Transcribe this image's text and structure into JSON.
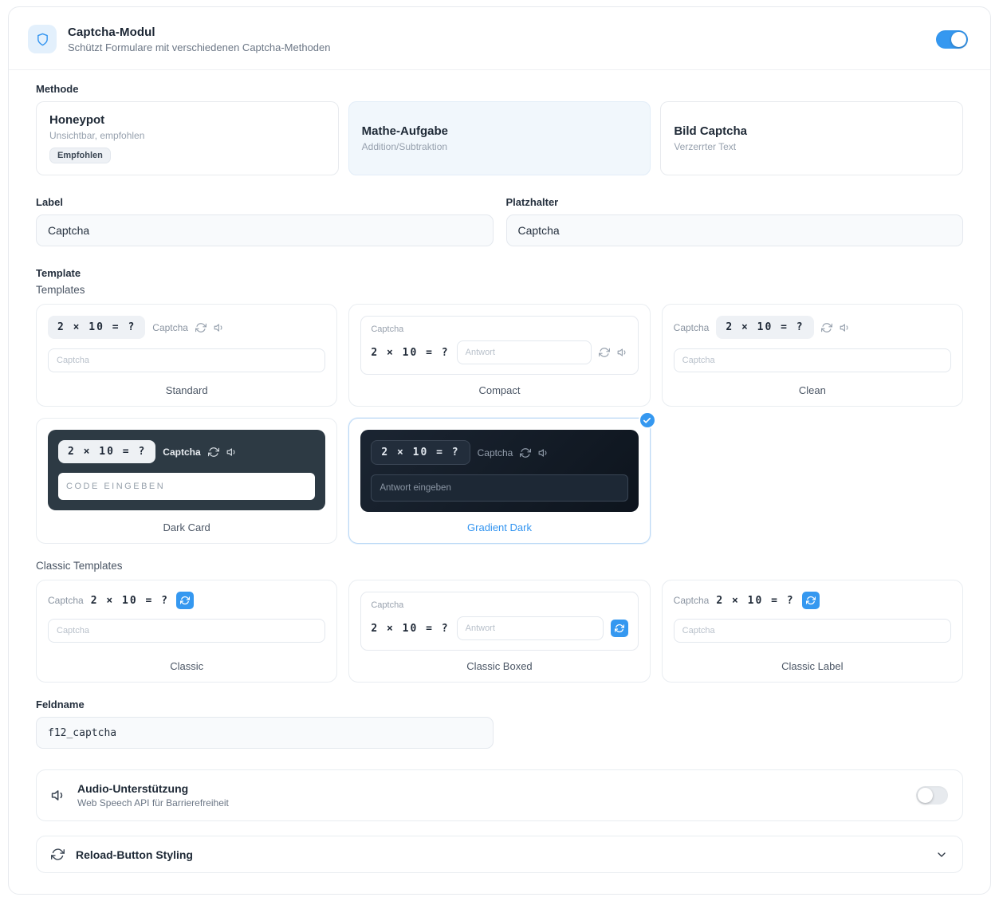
{
  "colors": {
    "accent": "#3598f0",
    "dark_card": "#2d3a44",
    "gradient_start": "#1b2532",
    "gradient_end": "#0d141d"
  },
  "header": {
    "title": "Captcha-Modul",
    "subtitle": "Schützt Formulare mit verschiedenen Captcha-Methoden",
    "enabled": true
  },
  "methode": {
    "label": "Methode",
    "options": [
      {
        "title": "Honeypot",
        "subtitle": "Unsichtbar, empfohlen",
        "badge": "Empfohlen",
        "selected": false
      },
      {
        "title": "Mathe-Aufgabe",
        "subtitle": "Addition/Subtraktion",
        "selected": true
      },
      {
        "title": "Bild Captcha",
        "subtitle": "Verzerrter Text",
        "selected": false
      }
    ]
  },
  "fields": {
    "label": {
      "label": "Label",
      "value": "Captcha"
    },
    "platzhalter": {
      "label": "Platzhalter",
      "value": "Captcha"
    },
    "feldname": {
      "label": "Feldname",
      "value": "f12_captcha"
    }
  },
  "templates": {
    "section_label": "Template",
    "group_label": "Templates",
    "classic_group_label": "Classic Templates",
    "question": "2 × 10 = ?",
    "items": [
      {
        "name": "Standard",
        "captcha_label": "Captcha",
        "input_placeholder": "Captcha",
        "selected": false
      },
      {
        "name": "Compact",
        "captcha_label": "Captcha",
        "input_placeholder": "Antwort",
        "selected": false
      },
      {
        "name": "Clean",
        "captcha_label": "Captcha",
        "input_placeholder": "Captcha",
        "selected": false
      },
      {
        "name": "Dark Card",
        "captcha_label": "Captcha",
        "input_placeholder": "CODE EINGEBEN",
        "selected": false
      },
      {
        "name": "Gradient Dark",
        "captcha_label": "Captcha",
        "input_placeholder": "Antwort eingeben",
        "selected": true
      }
    ],
    "classic_items": [
      {
        "name": "Classic",
        "captcha_label": "Captcha",
        "input_placeholder": "Captcha"
      },
      {
        "name": "Classic Boxed",
        "captcha_label": "Captcha",
        "input_placeholder": "Antwort"
      },
      {
        "name": "Classic Label",
        "captcha_label": "Captcha",
        "input_placeholder": "Captcha"
      }
    ]
  },
  "audio": {
    "title": "Audio-Unterstützung",
    "subtitle": "Web Speech API für Barrierefreiheit",
    "enabled": false
  },
  "reload_styling": {
    "title": "Reload-Button Styling",
    "expanded": false
  }
}
